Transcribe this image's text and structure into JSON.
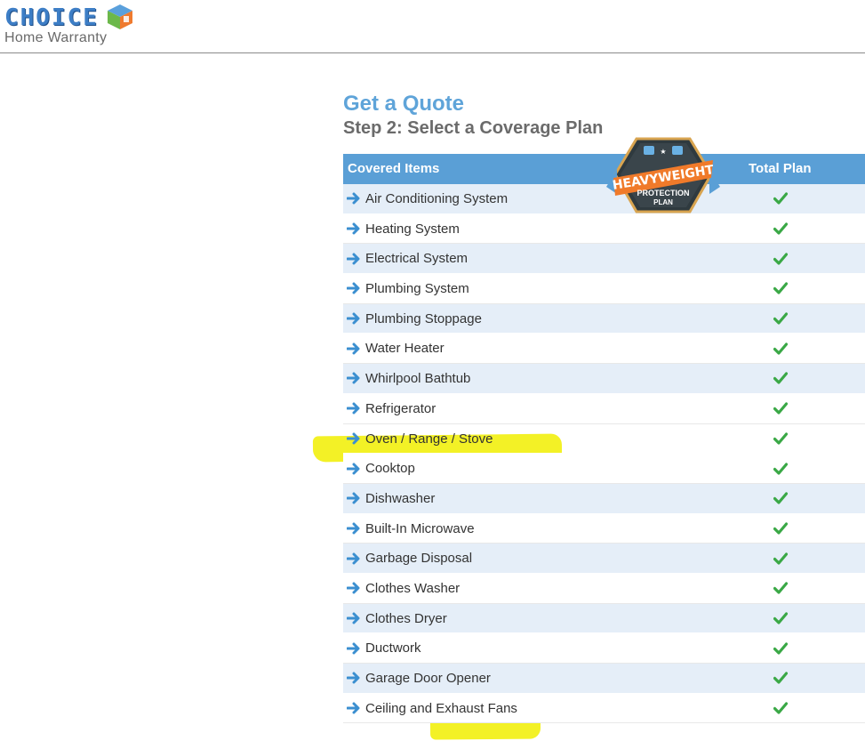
{
  "header": {
    "logo_word": "CHOICE",
    "logo_sub": "Home Warranty"
  },
  "page": {
    "title": "Get a Quote",
    "subtitle": "Step 2: Select a Coverage Plan"
  },
  "badge": {
    "line1": "HEAVYWEIGHT",
    "line2": "PROTECTION",
    "line3": "PLAN"
  },
  "table": {
    "col_items": "Covered Items",
    "col_plan": "Total Plan",
    "rows": [
      {
        "label": "Air Conditioning System"
      },
      {
        "label": "Heating System"
      },
      {
        "label": "Electrical System"
      },
      {
        "label": "Plumbing System"
      },
      {
        "label": "Plumbing Stoppage"
      },
      {
        "label": "Water Heater"
      },
      {
        "label": "Whirlpool Bathtub"
      },
      {
        "label": "Refrigerator"
      },
      {
        "label": "Oven / Range / Stove"
      },
      {
        "label": "Cooktop"
      },
      {
        "label": "Dishwasher"
      },
      {
        "label": "Built-In Microwave"
      },
      {
        "label": "Garbage Disposal"
      },
      {
        "label": "Clothes Washer"
      },
      {
        "label": "Clothes Dryer"
      },
      {
        "label": "Ductwork"
      },
      {
        "label": "Garage Door Opener"
      },
      {
        "label": "Ceiling and Exhaust Fans"
      }
    ]
  },
  "colors": {
    "accent_blue": "#5a9fd6",
    "title_blue": "#5fa4d9",
    "check_green": "#3aa846",
    "highlight": "#f1ef00",
    "badge_orange": "#f07a2a"
  }
}
